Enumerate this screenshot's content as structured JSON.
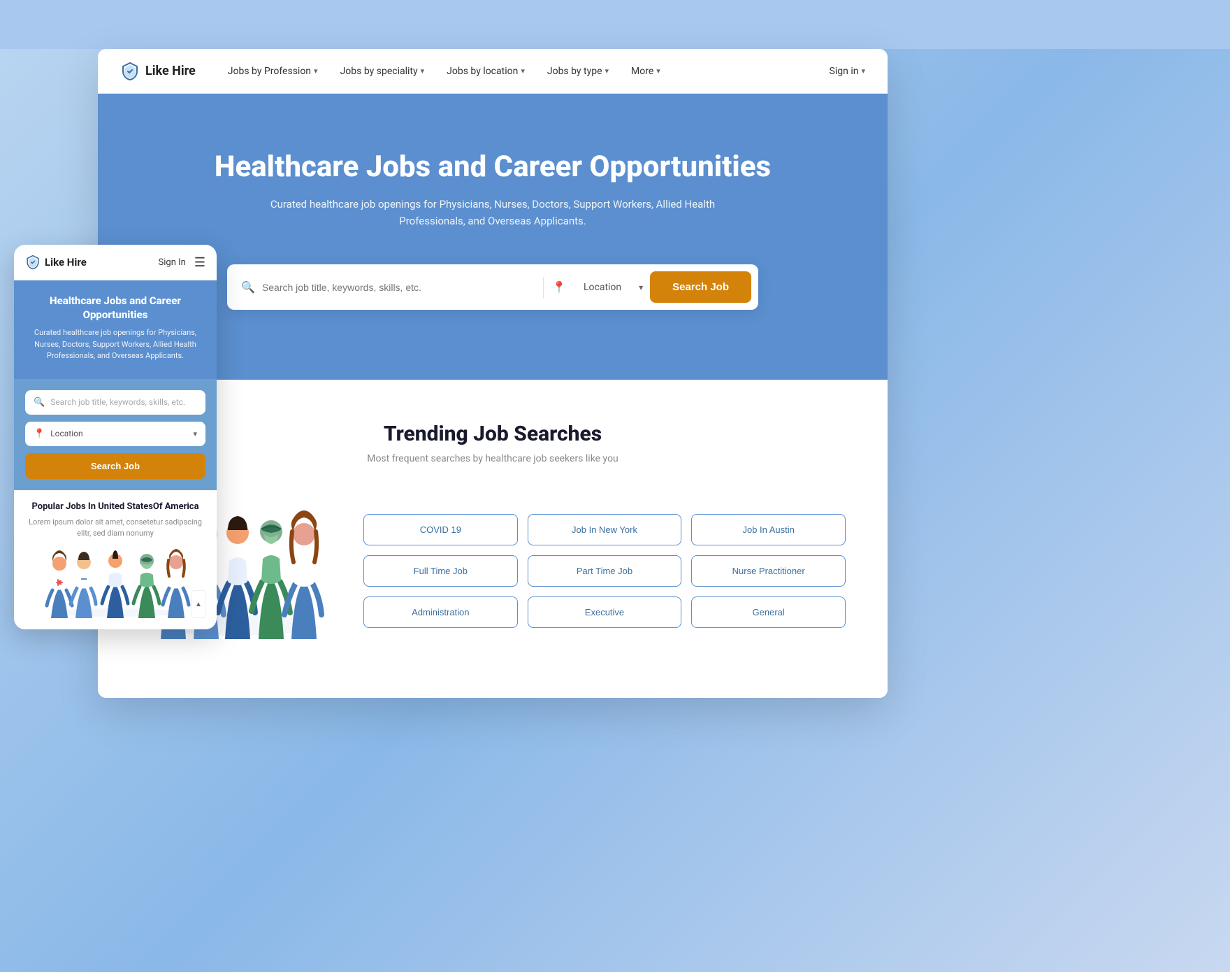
{
  "background": {
    "color": "#a8c8f0"
  },
  "desktop": {
    "navbar": {
      "logo_text": "Like Hire",
      "nav_items": [
        {
          "label": "Jobs by Profession",
          "has_chevron": true
        },
        {
          "label": "Jobs by speciality",
          "has_chevron": true
        },
        {
          "label": "Jobs by location",
          "has_chevron": true
        },
        {
          "label": "Jobs by type",
          "has_chevron": true
        },
        {
          "label": "More",
          "has_chevron": true
        }
      ],
      "signin_label": "Sign in"
    },
    "hero": {
      "title": "Healthcare Jobs and Career Opportunities",
      "subtitle": "Curated healthcare job openings for Physicians, Nurses, Doctors, Support Workers, Allied Health Professionals, and Overseas Applicants.",
      "search_placeholder": "Search job title, keywords, skills, etc.",
      "location_label": "Location",
      "search_button_label": "Search Job"
    },
    "trending": {
      "title": "Trending Job Searches",
      "subtitle": "Most frequent searches by healthcare job seekers like you",
      "tags": [
        "COVID 19",
        "Job In New York",
        "Job In Austin",
        "Full Time Job",
        "Part Time Job",
        "Nurse Practitioner",
        "Administration",
        "Executive",
        "General"
      ]
    }
  },
  "mobile": {
    "logo_text": "Like Hire",
    "signin_label": "Sign In",
    "hero": {
      "title": "Healthcare Jobs and Career Opportunities",
      "subtitle": "Curated healthcare job openings for Physicians, Nurses, Doctors, Support Workers, Allied Health Professionals, and Overseas Applicants."
    },
    "search": {
      "placeholder": "Search job title, keywords, skills, etc.",
      "location_label": "Location",
      "search_button_label": "Search Job"
    },
    "popular": {
      "title": "Popular Jobs In United StatesOf America",
      "subtitle": "Lorem ipsum dolor sit amet, consetetur sadipscing elitr, sed diam nonumy"
    }
  },
  "icons": {
    "logo": "shield",
    "search": "🔍",
    "location": "📍",
    "chevron_down": "▾",
    "hamburger": "☰"
  }
}
